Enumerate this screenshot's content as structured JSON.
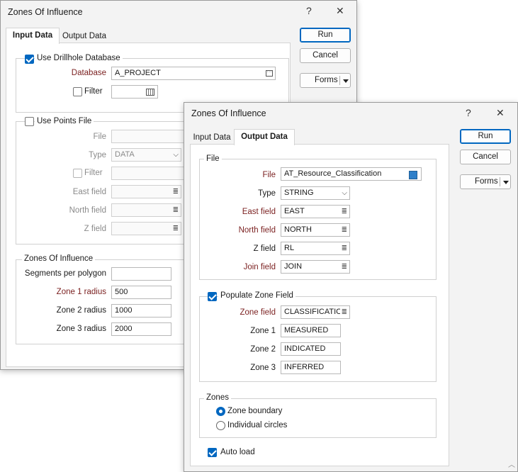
{
  "back_dialog": {
    "title": "Zones Of Influence",
    "help": "?",
    "close": "✕",
    "tabs": [
      "Input Data",
      "Output Data"
    ],
    "buttons": {
      "run": "Run",
      "cancel": "Cancel",
      "forms": "Forms"
    },
    "drillhole": {
      "label": "Use Drillhole Database",
      "checked": true,
      "database_label": "Database",
      "database_value": "A_PROJECT",
      "filter_label": "Filter"
    },
    "points": {
      "label": "Use Points File",
      "file_label": "File",
      "type_label": "Type",
      "type_value": "DATA",
      "filter_label": "Filter",
      "east_label": "East field",
      "north_label": "North field",
      "z_label": "Z field"
    },
    "zones": {
      "label": "Zones Of Influence",
      "segments_label": "Segments per polygon",
      "segments_value": "",
      "zone1_label": "Zone 1 radius",
      "zone1_value": "500",
      "zone2_label": "Zone 2 radius",
      "zone2_value": "1000",
      "zone3_label": "Zone 3 radius",
      "zone3_value": "2000"
    }
  },
  "front_dialog": {
    "title": "Zones Of Influence",
    "help": "?",
    "close": "✕",
    "tabs": [
      "Input Data",
      "Output Data"
    ],
    "buttons": {
      "run": "Run",
      "cancel": "Cancel",
      "forms": "Forms"
    },
    "file_group": {
      "label": "File",
      "file_label": "File",
      "file_value": "AT_Resource_Classification",
      "type_label": "Type",
      "type_value": "STRING",
      "east_label": "East field",
      "east_value": "EAST",
      "north_label": "North field",
      "north_value": "NORTH",
      "z_label": "Z field",
      "z_value": "RL",
      "join_label": "Join field",
      "join_value": "JOIN"
    },
    "populate": {
      "label": "Populate Zone Field",
      "checked": true,
      "zone_field_label": "Zone field",
      "zone_field_value": "CLASSIFICATIO",
      "zone1_label": "Zone 1",
      "zone1_value": "MEASURED",
      "zone2_label": "Zone 2",
      "zone2_value": "INDICATED",
      "zone3_label": "Zone 3",
      "zone3_value": "INFERRED"
    },
    "zones": {
      "label": "Zones",
      "boundary_label": "Zone boundary",
      "circles_label": "Individual circles",
      "selected": "Zone boundary"
    },
    "autoload": {
      "label": "Auto load",
      "checked": true
    }
  },
  "colors": {
    "accent": "#0067c0",
    "required_label": "#7a1f1f"
  }
}
